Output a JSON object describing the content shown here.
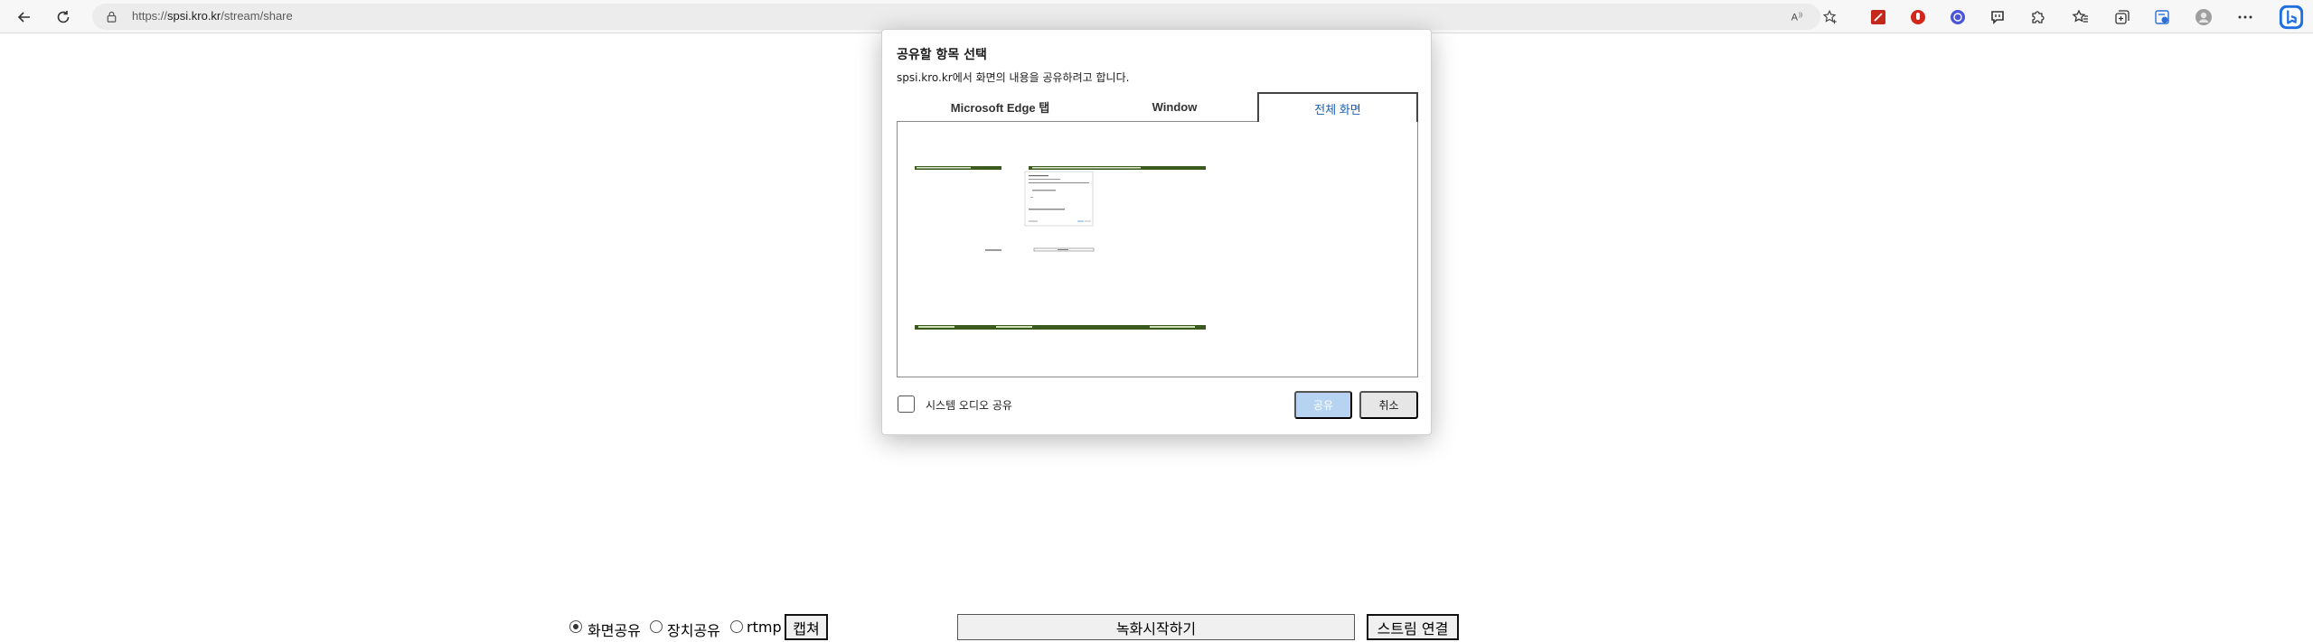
{
  "browser": {
    "url_scheme": "https://",
    "url_host": "spsi.kro.kr",
    "url_path": "/stream/share",
    "icons": [
      "back-icon",
      "refresh-icon",
      "lock-icon",
      "read-aloud-icon",
      "favorite-add-icon",
      "extension-pdf-icon",
      "extension-shield-icon",
      "extension-globe-icon",
      "extension-chat-icon",
      "extensions-icon",
      "favorites-icon",
      "collections-icon",
      "browser-essentials-icon",
      "profile-icon",
      "more-icon",
      "bing-copilot-icon"
    ]
  },
  "page": {
    "radio_screen": "화면공유",
    "radio_device": "장치공유",
    "radio_rtmp": "rtmp",
    "selected_radio": "screen",
    "capture_label": "캡쳐",
    "record_label": "녹화시작하기",
    "stream_label": "스트림 연결"
  },
  "dialog": {
    "title": "공유할 항목 선택",
    "subtitle": "spsi.kro.kr에서 화면의 내용을 공유하려고 합니다.",
    "tabs": [
      {
        "label": "Microsoft Edge 탭",
        "active": false
      },
      {
        "label": "Window",
        "active": false
      },
      {
        "label": "전체 화면",
        "active": true
      }
    ],
    "audio_label": "시스템 오디오 공유",
    "audio_checked": false,
    "share_label": "공유",
    "share_enabled": false,
    "cancel_label": "취소"
  },
  "colors": {
    "accent": "#1a5fb4",
    "share_disabled": "#b6d4f2",
    "taskbar_green": "#3a5a1e"
  }
}
